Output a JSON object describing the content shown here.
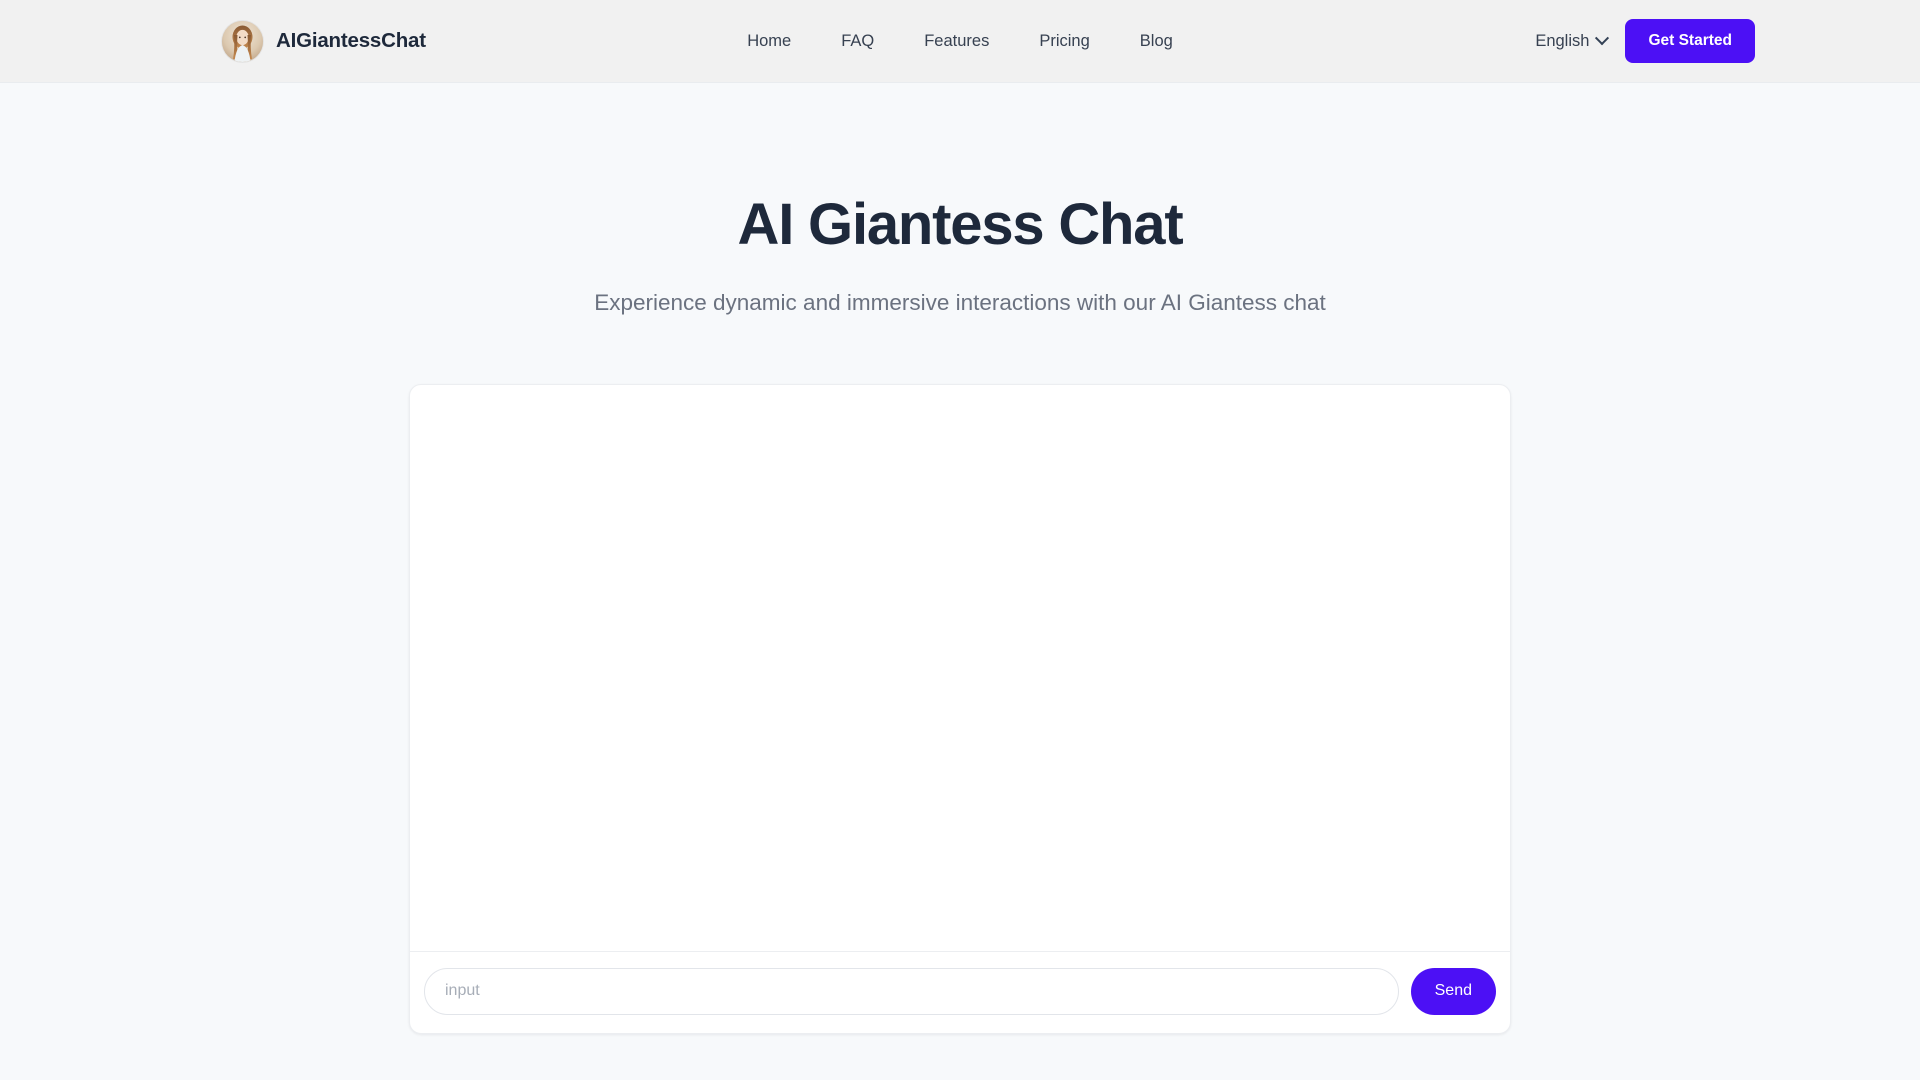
{
  "header": {
    "brand": {
      "name": "AIGiantessChat",
      "avatar_icon": "woman-portrait-avatar"
    },
    "nav": [
      {
        "label": "Home"
      },
      {
        "label": "FAQ"
      },
      {
        "label": "Features"
      },
      {
        "label": "Pricing"
      },
      {
        "label": "Blog"
      }
    ],
    "language": {
      "selected": "English",
      "chevron_icon": "chevron-down-icon"
    },
    "cta": {
      "label": "Get Started"
    },
    "colors": {
      "background": "#f1f1f1",
      "accent": "#4c10f5",
      "text": "#374151"
    }
  },
  "hero": {
    "title": "AI Giantess Chat",
    "subtitle": "Experience dynamic and immersive interactions with our AI Giantess chat",
    "title_color": "#1e293b",
    "subtitle_color": "#6b7280"
  },
  "chat": {
    "messages": [],
    "input": {
      "value": "",
      "placeholder": "input"
    },
    "send": {
      "label": "Send",
      "color": "#4c10f5"
    }
  },
  "page": {
    "background": "#f7f9fb"
  }
}
